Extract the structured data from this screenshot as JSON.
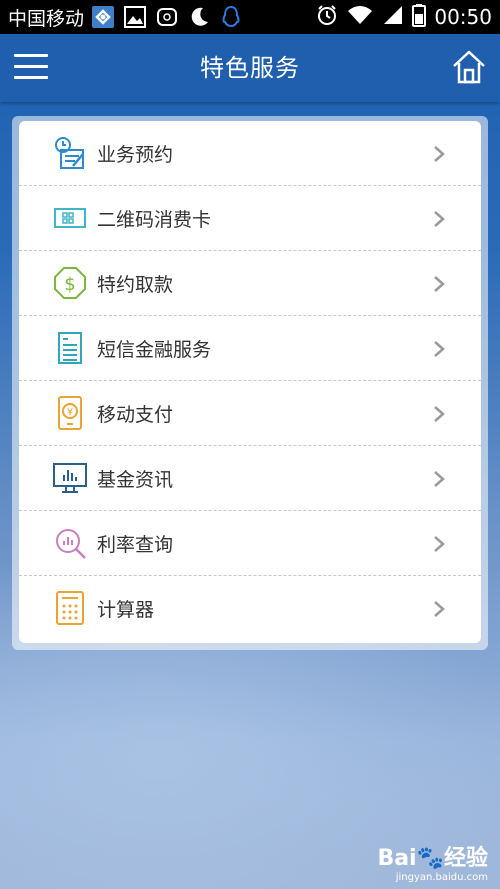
{
  "status_bar": {
    "carrier": "中国移动",
    "time": "00:50",
    "icons": [
      "app-icon",
      "image-icon",
      "sim-icon",
      "moon-icon",
      "qq-icon",
      "alarm-icon",
      "wifi-icon",
      "signal-icon",
      "battery-icon"
    ]
  },
  "header": {
    "title": "特色服务",
    "menu_icon": "hamburger-icon",
    "home_icon": "home-icon"
  },
  "menu": {
    "items": [
      {
        "label": "业务预约",
        "icon": "appointment-icon",
        "color": "#2a8bd0"
      },
      {
        "label": "二维码消费卡",
        "icon": "qr-card-icon",
        "color": "#3fb6c8"
      },
      {
        "label": "特约取款",
        "icon": "dollar-icon",
        "color": "#7bb73a"
      },
      {
        "label": "短信金融服务",
        "icon": "sms-document-icon",
        "color": "#2fa7b8"
      },
      {
        "label": "移动支付",
        "icon": "mobile-pay-icon",
        "color": "#e8a534"
      },
      {
        "label": "基金资讯",
        "icon": "fund-chart-icon",
        "color": "#2a5f8a"
      },
      {
        "label": "利率查询",
        "icon": "rate-search-icon",
        "color": "#c77fc0"
      },
      {
        "label": "计算器",
        "icon": "calculator-icon",
        "color": "#e8a534"
      }
    ]
  },
  "watermark": {
    "logo": "Bai🐾经验",
    "url": "jingyan.baidu.com"
  }
}
